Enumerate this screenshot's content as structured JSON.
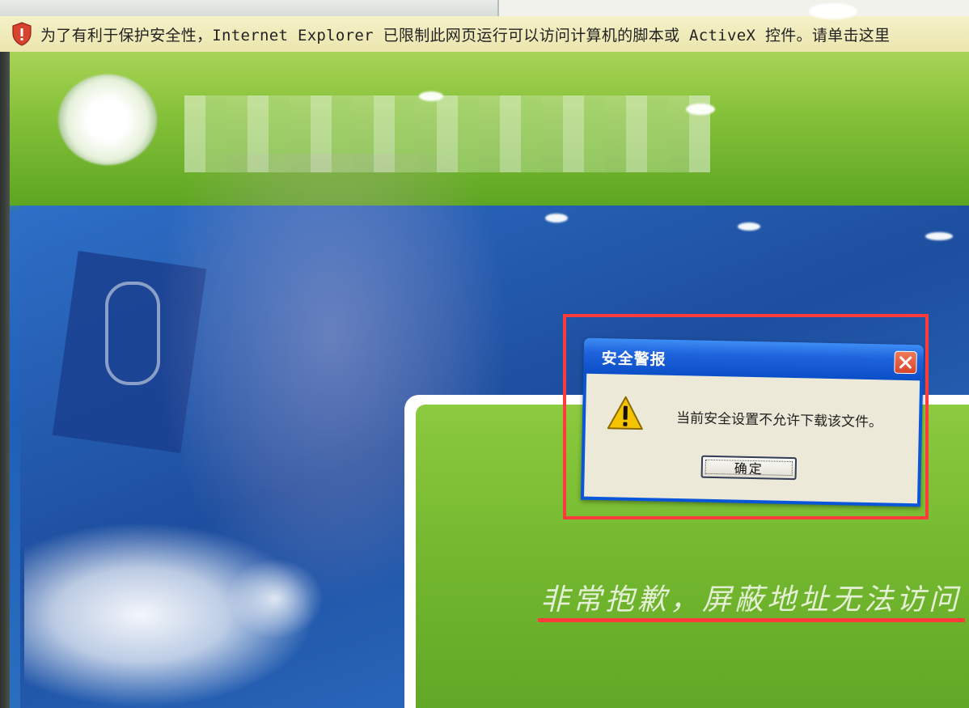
{
  "browser": {
    "infobar": {
      "icon": "shield-warning-icon",
      "text": "为了有利于保护安全性，Internet Explorer 已限制此网页运行可以访问计算机的脚本或 ActiveX 控件。请单击这里"
    }
  },
  "page": {
    "blocked_message": "非常抱歉，屏蔽地址无法访问"
  },
  "dialog": {
    "title": "安全警报",
    "message": "当前安全设置不允许下载该文件。",
    "ok_label": "确定",
    "close_icon": "close-icon",
    "warning_icon": "warning-icon"
  },
  "colors": {
    "highlight": "#ff3b3b",
    "titlebar": "#1e63dc",
    "infobar": "#f5f1c8"
  }
}
